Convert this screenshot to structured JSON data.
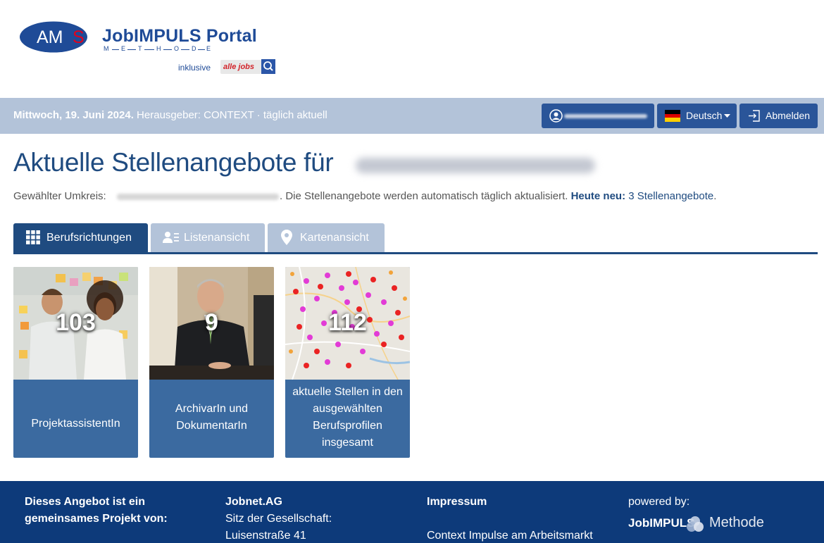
{
  "header": {
    "ams_logo": "AMS",
    "portal_title": "JobIMPULS Portal",
    "methode_letters": [
      "M",
      "E",
      "T",
      "H",
      "O",
      "D",
      "E"
    ],
    "inklusive": "inklusive",
    "alljobs_logo": "alle jobs"
  },
  "topbar": {
    "date": "Mittwoch, 19. Juni 2024.",
    "publisher": " Herausgeber: CONTEXT · täglich aktuell",
    "language_label": "Deutsch",
    "logout_label": "Abmelden"
  },
  "main": {
    "title": "Aktuelle Stellenangebote für",
    "radius_label": "Gewählter Umkreis:",
    "radius_tail": ". Die Stellenangebote werden automatisch täglich aktualisiert.",
    "today_new_label": "Heute neu:",
    "today_new_value": "3 Stellenangebote",
    "today_new_end": "."
  },
  "tabs": [
    {
      "label": "Berufsrichtungen",
      "active": true
    },
    {
      "label": "Listenansicht",
      "active": false
    },
    {
      "label": "Kartenansicht",
      "active": false
    }
  ],
  "cards": [
    {
      "count": "103",
      "label": "ProjektassistentIn"
    },
    {
      "count": "9",
      "label": "ArchivarIn und DokumentarIn"
    },
    {
      "count": "112",
      "label": "aktuelle Stellen in den ausgewählten Berufsprofilen insgesamt"
    }
  ],
  "footer": {
    "col1_line1": "Dieses Angebot ist ein",
    "col1_line2": "gemeinsames Projekt von:",
    "col2_title": "Jobnet.AG",
    "col2_line1": "Sitz der Gesellschaft:",
    "col2_line2": "Luisenstraße 41",
    "col3_title": "Impressum",
    "col3_line1": "Context Impulse am Arbeitsmarkt",
    "col4_title": "powered by:",
    "logo_jobimpuls": "JobIMPULS",
    "logo_methode": "Methode"
  },
  "colors": {
    "primary": "#1f4b80",
    "topbar": "#b3c3d9",
    "button": "#2a5599",
    "card": "#3b6aa0",
    "footer": "#0d3a7a"
  }
}
